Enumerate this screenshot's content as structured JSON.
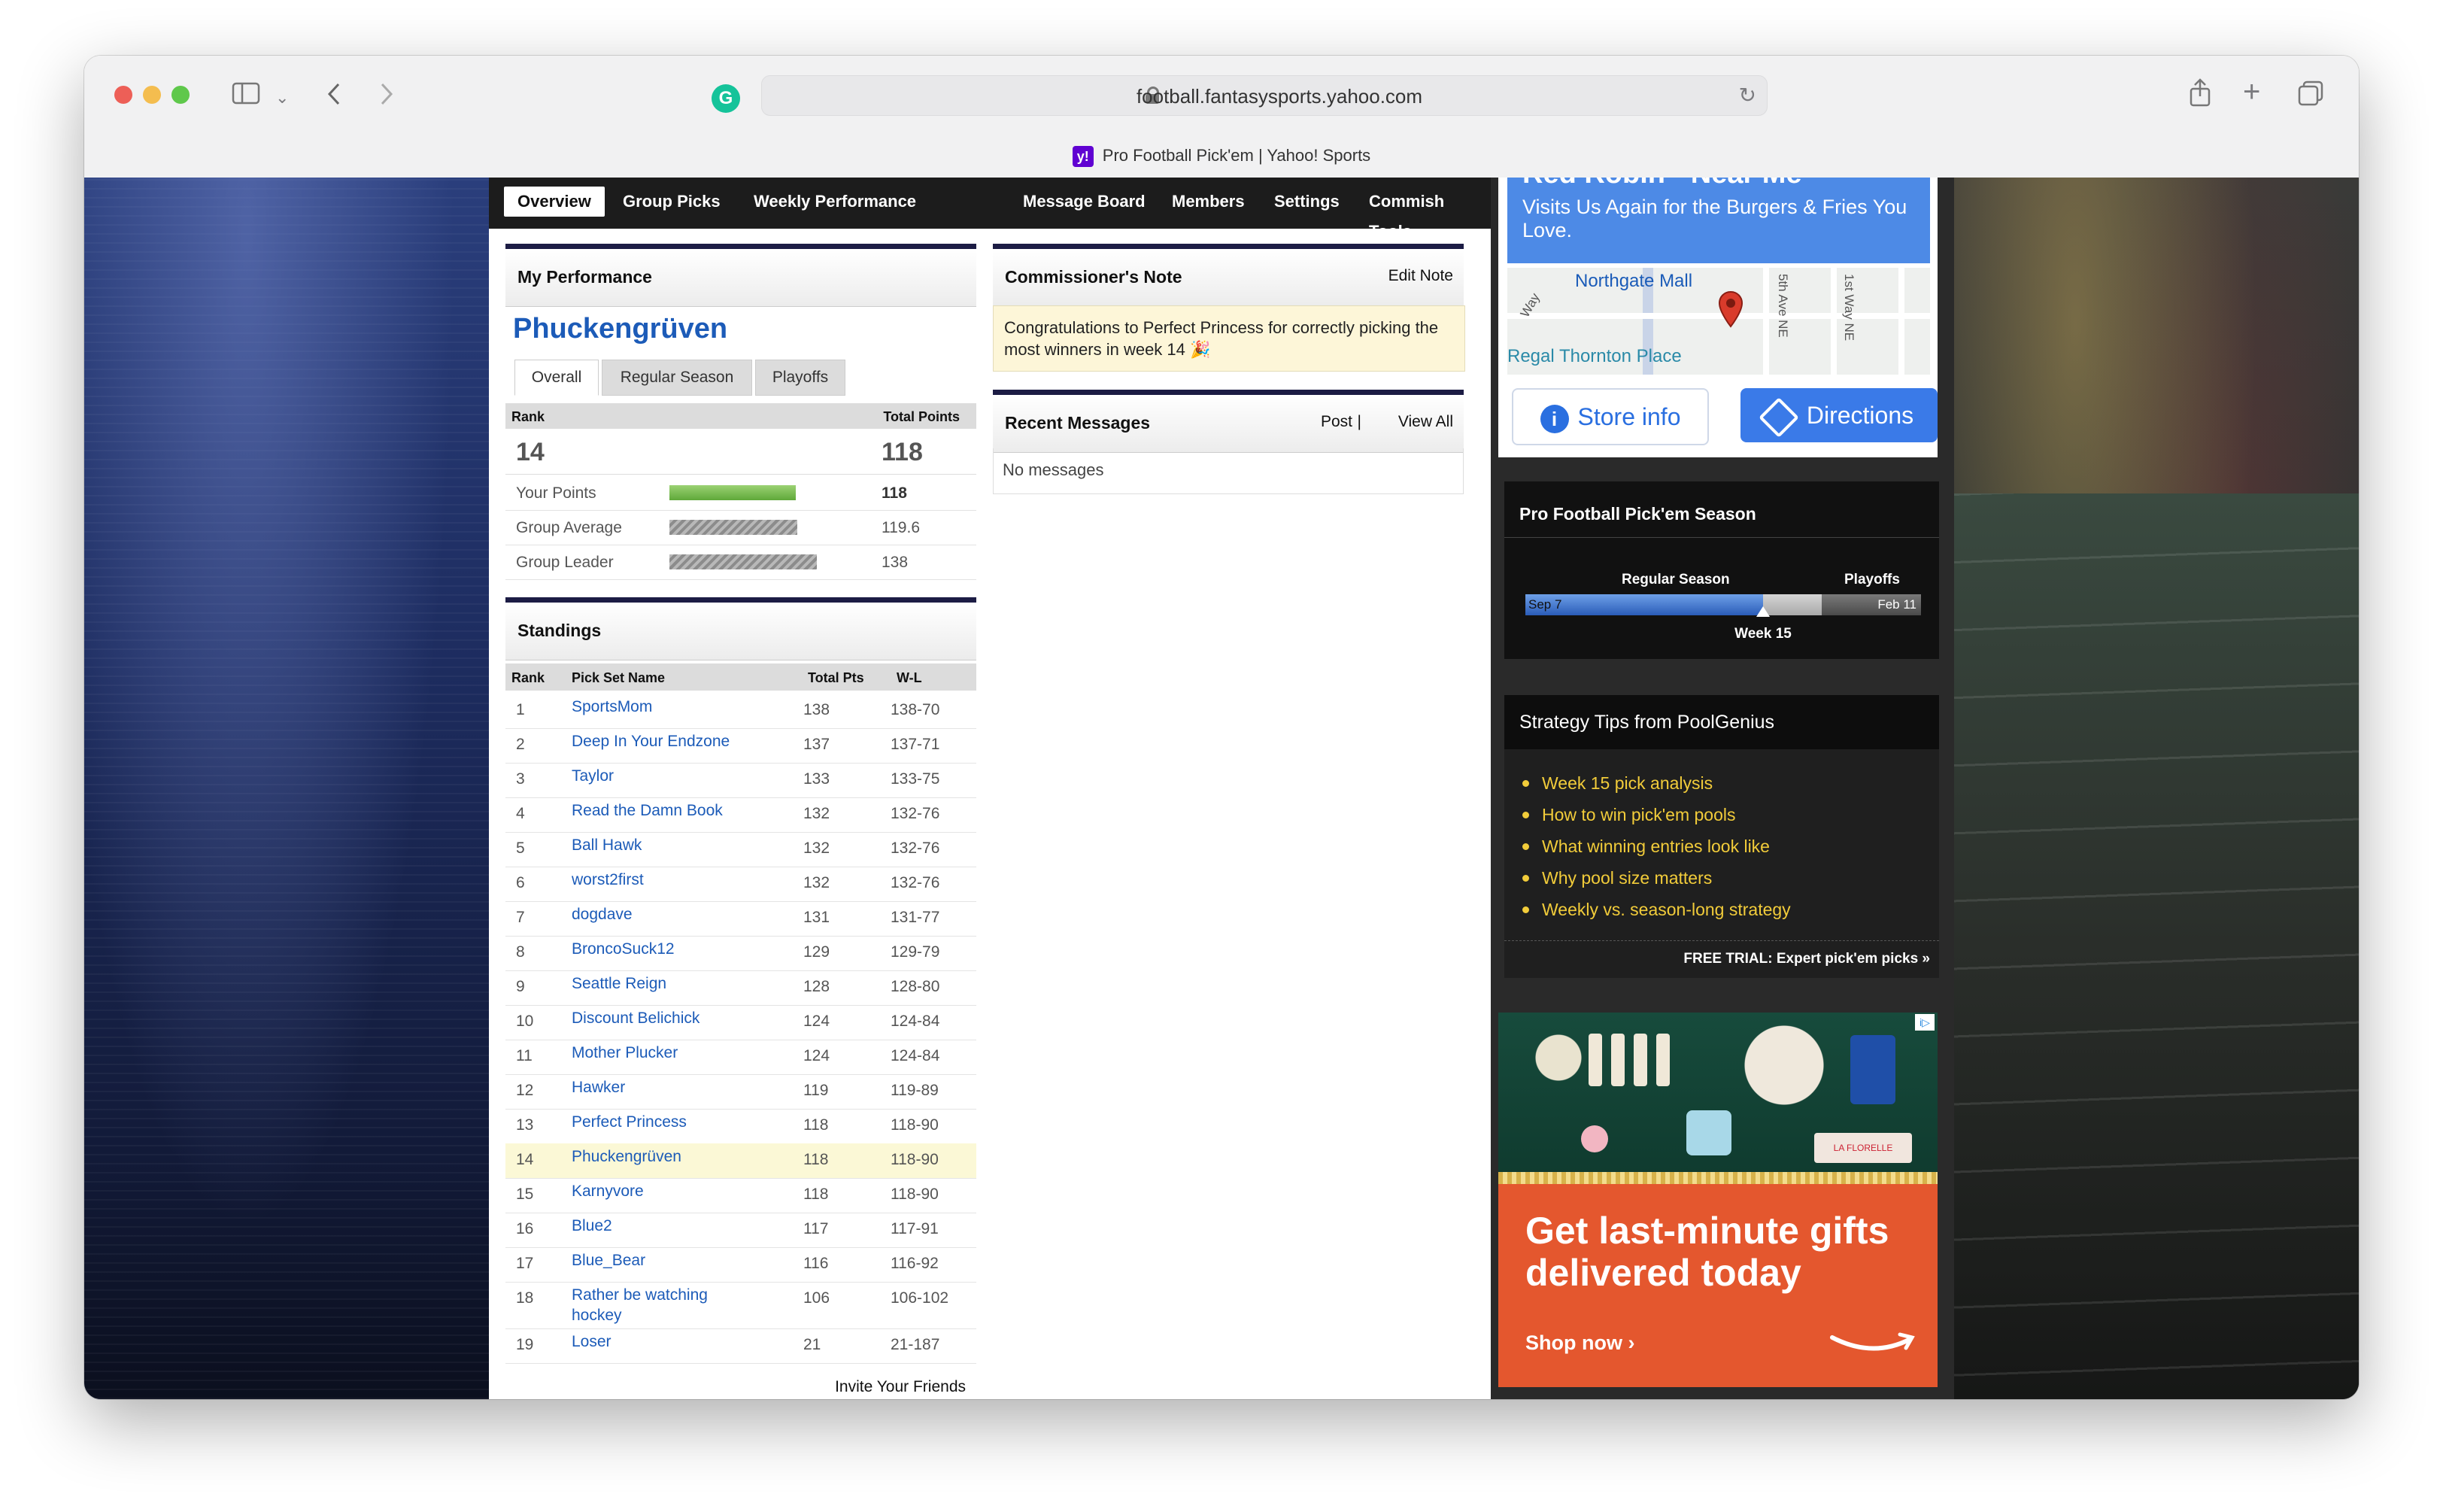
{
  "browser": {
    "url": "football.fantasysports.yahoo.com",
    "tab_title": "Pro Football Pick'em | Yahoo! Sports",
    "favicon_text": "y!"
  },
  "nav": {
    "tabs": [
      "Overview",
      "Group Picks",
      "Weekly Performance",
      "Message Board",
      "Members",
      "Settings",
      "Commish Tools"
    ]
  },
  "performance": {
    "title": "My Performance",
    "team_name": "Phuckengrüven",
    "subtabs": [
      "Overall",
      "Regular Season",
      "Playoffs"
    ],
    "rank_label": "Rank",
    "points_label": "Total Points",
    "rank": "14",
    "total_points": "118",
    "rows": [
      {
        "label": "Your Points",
        "value": "118",
        "bar_fraction": 0.855,
        "color": "green"
      },
      {
        "label": "Group Average",
        "value": "119.6",
        "bar_fraction": 0.867,
        "color": "gray"
      },
      {
        "label": "Group Leader",
        "value": "138",
        "bar_fraction": 1.0,
        "color": "gray"
      }
    ]
  },
  "standings": {
    "title": "Standings",
    "headers": [
      "Rank",
      "Pick Set Name",
      "Total Pts",
      "W-L"
    ],
    "rows": [
      {
        "rank": "1",
        "name": "SportsMom",
        "pts": "138",
        "wl": "138-70"
      },
      {
        "rank": "2",
        "name": "Deep In Your Endzone",
        "pts": "137",
        "wl": "137-71"
      },
      {
        "rank": "3",
        "name": "Taylor",
        "pts": "133",
        "wl": "133-75"
      },
      {
        "rank": "4",
        "name": "Read the Damn Book",
        "pts": "132",
        "wl": "132-76"
      },
      {
        "rank": "5",
        "name": "Ball Hawk",
        "pts": "132",
        "wl": "132-76"
      },
      {
        "rank": "6",
        "name": "worst2first",
        "pts": "132",
        "wl": "132-76"
      },
      {
        "rank": "7",
        "name": "dogdave",
        "pts": "131",
        "wl": "131-77"
      },
      {
        "rank": "8",
        "name": "BroncoSuck12",
        "pts": "129",
        "wl": "129-79"
      },
      {
        "rank": "9",
        "name": "Seattle Reign",
        "pts": "128",
        "wl": "128-80"
      },
      {
        "rank": "10",
        "name": "Discount Belichick",
        "pts": "124",
        "wl": "124-84"
      },
      {
        "rank": "11",
        "name": "Mother Plucker",
        "pts": "124",
        "wl": "124-84"
      },
      {
        "rank": "12",
        "name": "Hawker",
        "pts": "119",
        "wl": "119-89"
      },
      {
        "rank": "13",
        "name": "Perfect Princess",
        "pts": "118",
        "wl": "118-90"
      },
      {
        "rank": "14",
        "name": "Phuckengrüven",
        "pts": "118",
        "wl": "118-90"
      },
      {
        "rank": "15",
        "name": "Karnyvore",
        "pts": "118",
        "wl": "118-90"
      },
      {
        "rank": "16",
        "name": "Blue2",
        "pts": "117",
        "wl": "117-91"
      },
      {
        "rank": "17",
        "name": "Blue_Bear",
        "pts": "116",
        "wl": "116-92"
      },
      {
        "rank": "18",
        "name": "Rather be watching hockey",
        "pts": "106",
        "wl": "106-102"
      },
      {
        "rank": "19",
        "name": "Loser",
        "pts": "21",
        "wl": "21-187"
      }
    ],
    "invite_label": "Invite Your Friends"
  },
  "commissioner": {
    "title": "Commissioner's Note",
    "edit_label": "Edit Note",
    "note": "Congratulations to Perfect Princess for correctly picking the most winners in week 14 🎉"
  },
  "messages": {
    "title": "Recent Messages",
    "post_label": "Post",
    "view_all_label": "View All",
    "empty_text": "No messages"
  },
  "ad_redrobin": {
    "headline": "Red Robin - Near Me",
    "tagline": "Visits Us Again for the Burgers & Fries You Love.",
    "map_label_mall": "Northgate Mall",
    "map_label_place": "Regal Thornton Place",
    "map_label_ave": "5th Ave NE",
    "map_label_way": "1st Way NE",
    "map_label_left": "Way",
    "store_info_label": "Store info",
    "directions_label": "Directions"
  },
  "season": {
    "title": "Pro Football Pick'em Season",
    "regular_label": "Regular Season",
    "playoffs_label": "Playoffs",
    "start_label": "Sep 7",
    "end_label": "Feb 11",
    "current_label": "Week 15",
    "progress_fraction": 0.6,
    "regular_fraction": 0.75
  },
  "tips": {
    "title": "Strategy Tips from PoolGenius",
    "items": [
      "Week 15 pick analysis",
      "How to win pick'em pools",
      "What winning entries look like",
      "Why pool size matters",
      "Weekly vs. season-long strategy"
    ],
    "trial_label": "FREE TRIAL: Expert pick'em picks »"
  },
  "ad_amazon": {
    "headline_line1": "Get last-minute gifts",
    "headline_line2": "delivered today",
    "cta": "Shop now ›",
    "badge": "i▷",
    "product_label": "LA FLORELLE"
  },
  "colors": {
    "link_blue": "#1c5bb8",
    "tip_yellow": "#f2cc3a",
    "amazon_orange": "#e4572e",
    "highlight_row": "#fbf8d6"
  }
}
